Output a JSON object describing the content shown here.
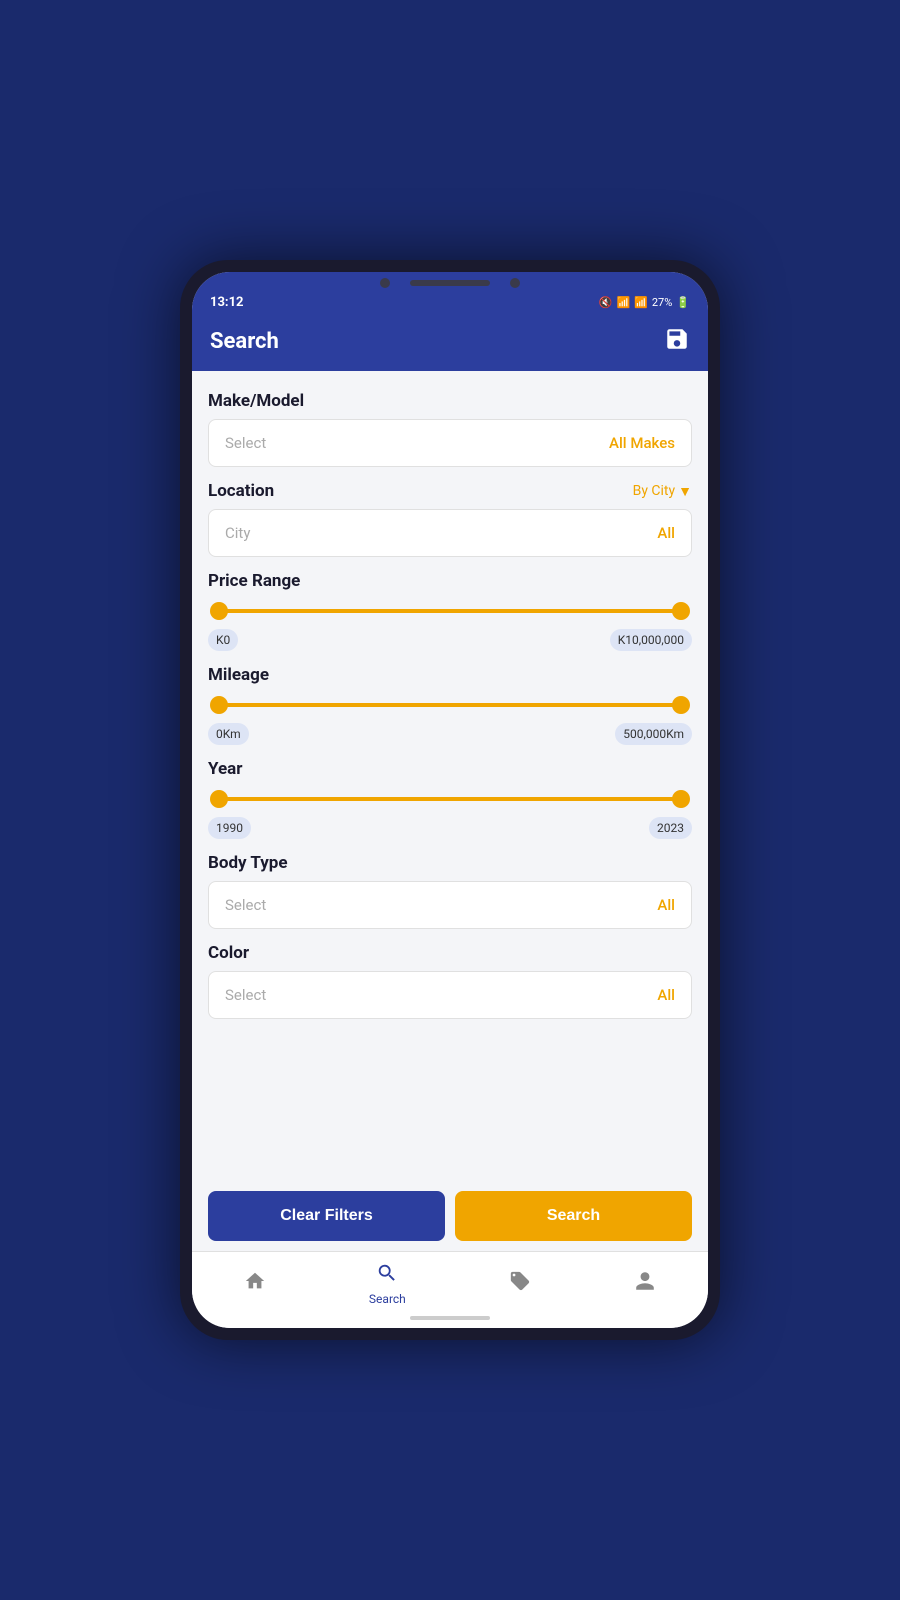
{
  "statusBar": {
    "time": "13:12",
    "battery": "27%"
  },
  "header": {
    "title": "Search",
    "saveIcon": "💾"
  },
  "sections": {
    "makeModel": {
      "label": "Make/Model",
      "placeholder": "Select",
      "badge": "All Makes"
    },
    "location": {
      "label": "Location",
      "byLabel": "By City",
      "cityPlaceholder": "City",
      "cityBadge": "All"
    },
    "priceRange": {
      "label": "Price Range",
      "minLabel": "K0",
      "maxLabel": "K10,000,000"
    },
    "mileage": {
      "label": "Mileage",
      "minLabel": "0Km",
      "maxLabel": "500,000Km"
    },
    "year": {
      "label": "Year",
      "minLabel": "1990",
      "maxLabel": "2023"
    },
    "bodyType": {
      "label": "Body Type",
      "placeholder": "Select",
      "badge": "All"
    },
    "color": {
      "label": "Color",
      "placeholder": "Select",
      "badge": "All"
    }
  },
  "buttons": {
    "clearFilters": "Clear Filters",
    "search": "Search"
  },
  "bottomNav": {
    "items": [
      {
        "label": "",
        "icon": "🏠",
        "active": false
      },
      {
        "label": "Search",
        "icon": "🔍",
        "active": true
      },
      {
        "label": "",
        "icon": "🏷",
        "active": false
      },
      {
        "label": "",
        "icon": "👤",
        "active": false
      }
    ]
  }
}
